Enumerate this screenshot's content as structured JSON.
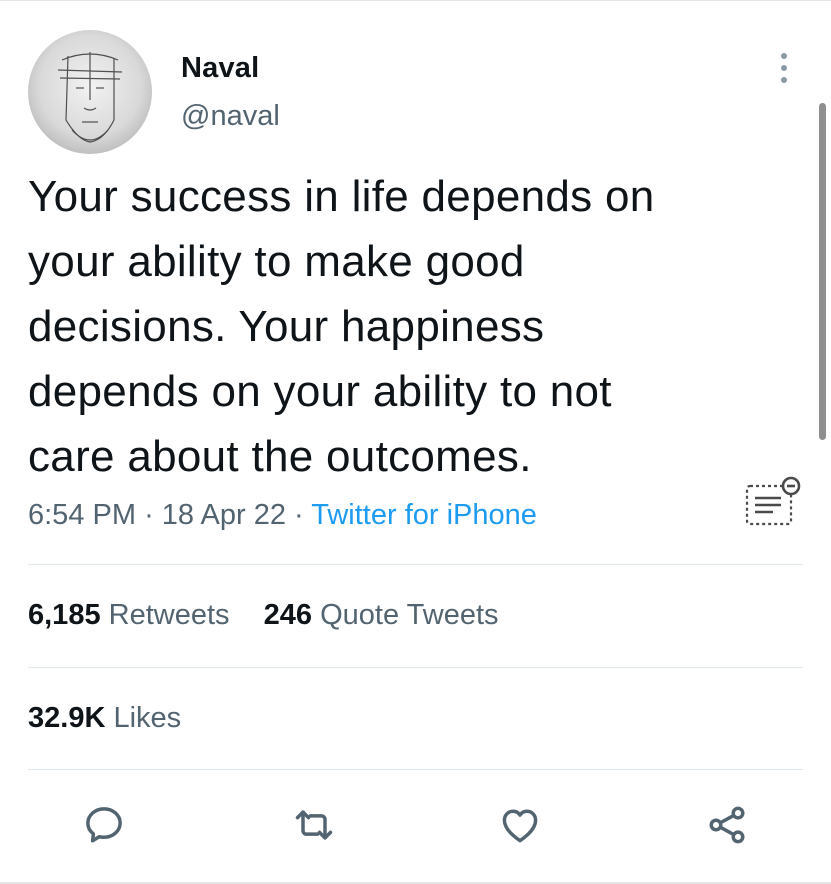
{
  "author": {
    "name": "Naval",
    "handle": "@naval"
  },
  "tweet": {
    "text_lines": [
      "Your success in life depends on",
      "your ability to make good",
      "decisions. Your happiness",
      "depends on your ability to not",
      "care about the outcomes."
    ],
    "time": "6:54 PM",
    "date": "18 Apr 22",
    "separator": "·",
    "source": "Twitter for iPhone"
  },
  "stats": {
    "retweets_count": "6,185",
    "retweets_label": "Retweets",
    "quote_count": "246",
    "quote_label": "Quote Tweets",
    "likes_count": "32.9K",
    "likes_label": "Likes"
  },
  "actions": [
    {
      "name": "reply",
      "icon": "reply-icon"
    },
    {
      "name": "retweet",
      "icon": "retweet-icon"
    },
    {
      "name": "like",
      "icon": "heart-icon"
    },
    {
      "name": "share",
      "icon": "share-icon"
    }
  ],
  "colors": {
    "text": "#0f1419",
    "secondary": "#536471",
    "accent": "#1d9bf0",
    "divider": "#e1e8ed"
  }
}
